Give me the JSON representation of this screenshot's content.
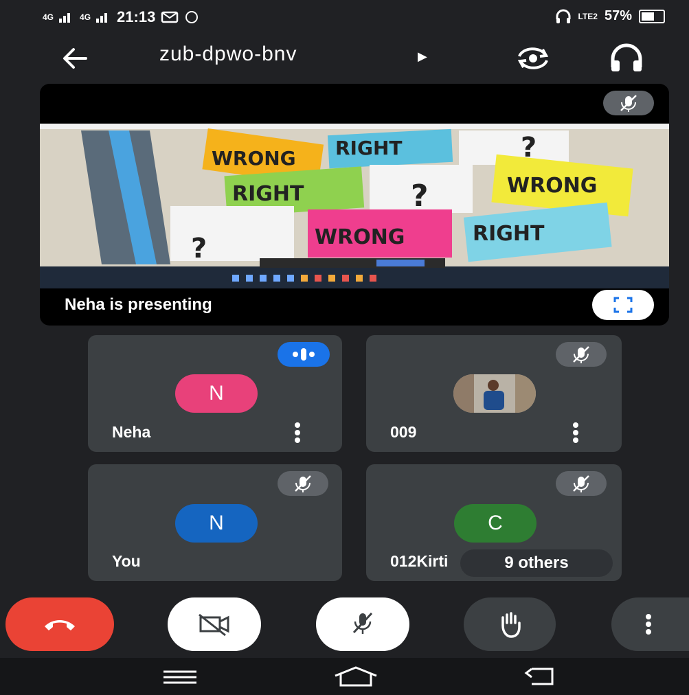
{
  "status_bar": {
    "time": "21:13",
    "signal_1": "4G",
    "signal_2": "4G",
    "network_label": "LTE2",
    "battery": "57%"
  },
  "meeting": {
    "code": "zub-dpwo-bnv"
  },
  "presentation": {
    "label": "Neha is presenting",
    "slide_words": [
      "WRONG",
      "RIGHT",
      "RIGHT",
      "WRONG",
      "WRONG",
      "RIGHT"
    ]
  },
  "participants": [
    {
      "name": "Neha",
      "initial": "N",
      "avatar_color": "#e8417a",
      "state": "speaking"
    },
    {
      "name": "009",
      "initial": "",
      "avatar_color": "#777777",
      "state": "muted"
    },
    {
      "name": "You",
      "initial": "N",
      "avatar_color": "#1565c0",
      "state": "muted"
    },
    {
      "name": "012Kirti",
      "initial": "C",
      "avatar_color": "#2e7d32",
      "state": "muted"
    }
  ],
  "others_label": "9 others",
  "colors": {
    "end_call": "#ea4335",
    "background": "#202124",
    "tile": "#3c4043",
    "accent": "#1a73e8"
  },
  "controls": [
    "end-call",
    "camera-off",
    "mic-off",
    "raise-hand",
    "more-options"
  ]
}
